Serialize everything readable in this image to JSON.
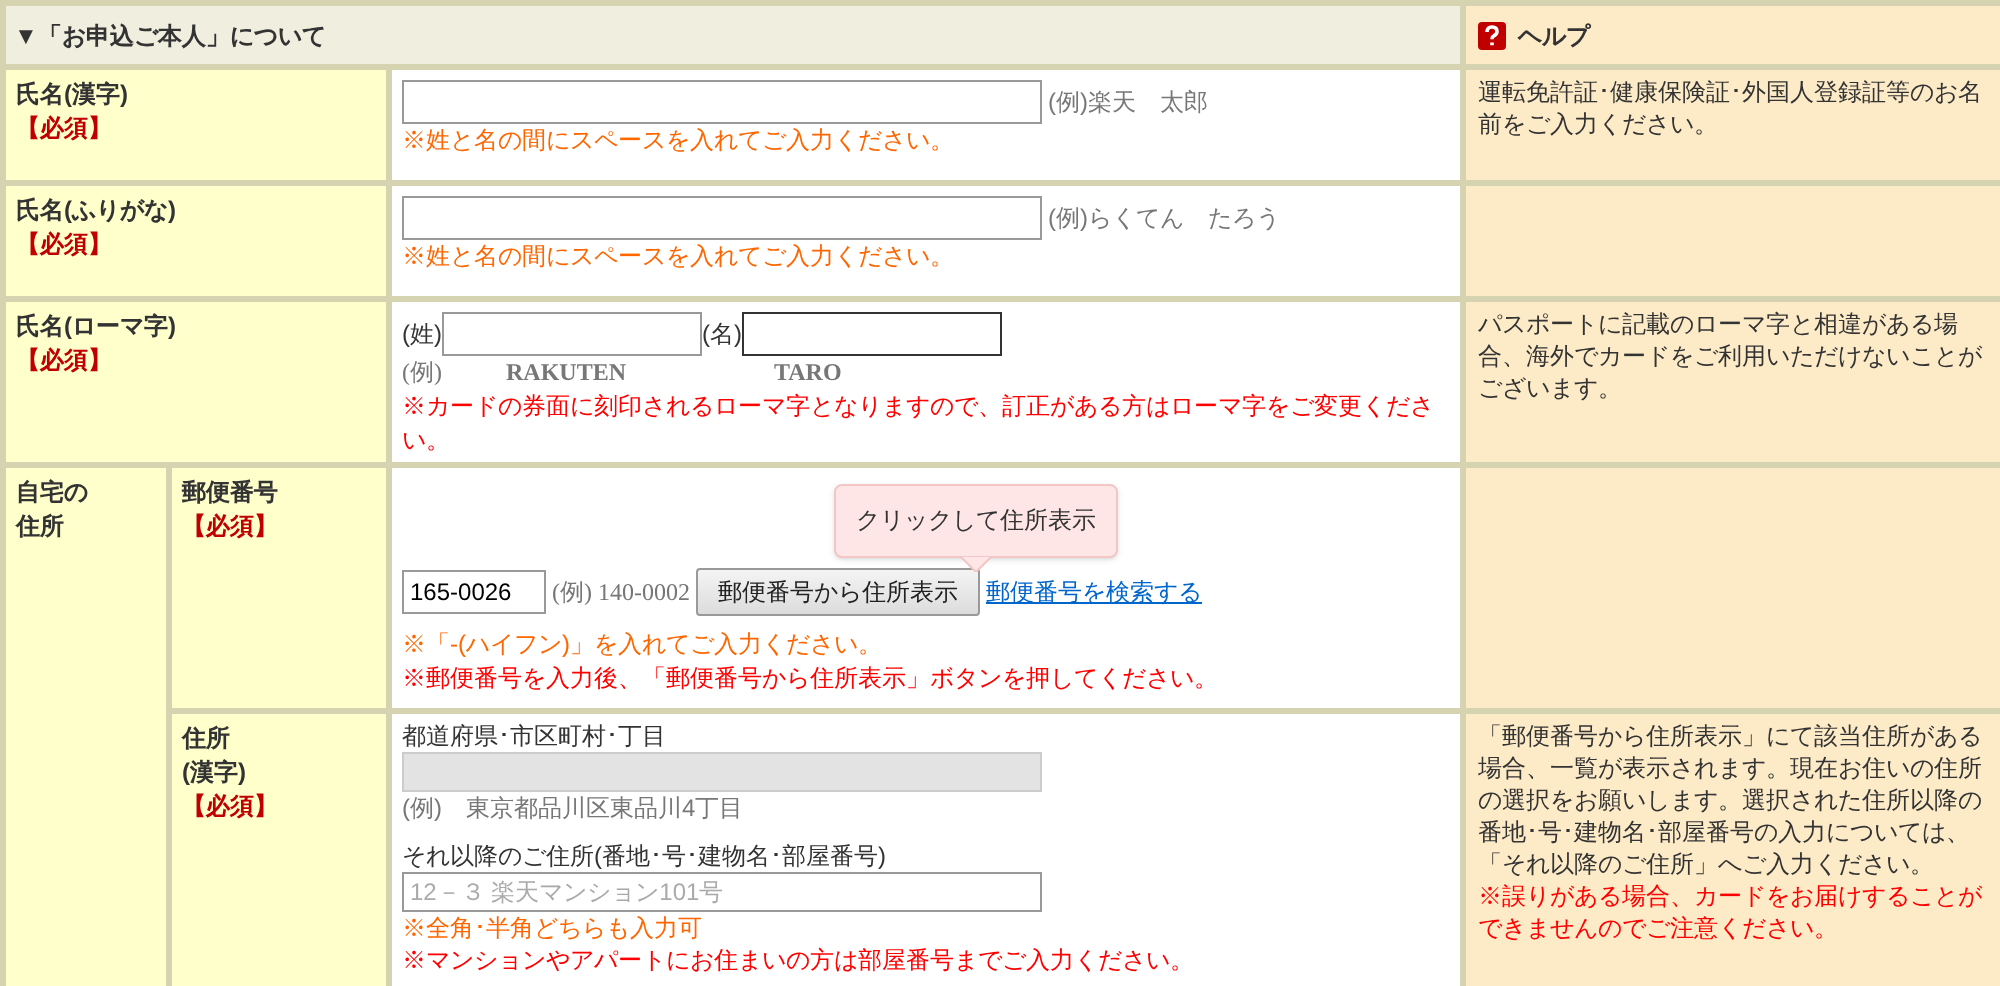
{
  "section": {
    "title": "▼「お申込ご本人」について"
  },
  "help_header": {
    "title": "ヘルプ"
  },
  "rows": [
    {
      "kind": "single",
      "label": [
        "氏名(漢字)"
      ],
      "required": "【必須】",
      "input": {
        "focused": false
      },
      "example": "(例)楽天　太郎",
      "notes": [
        {
          "text": "※姓と名の間にスペースを入れてご入力ください。",
          "color": "#ff6600"
        }
      ],
      "help": [
        {
          "text": "運転免許証･健康保険証･外国人登録証等のお名前をご入力ください。",
          "color": "#333333"
        }
      ]
    },
    {
      "kind": "single",
      "label": [
        "氏名(ふりがな)"
      ],
      "required": "【必須】",
      "input": {
        "focused": false
      },
      "example": "(例)らくてん　たろう",
      "notes": [
        {
          "text": "※姓と名の間にスペースを入れてご入力ください。",
          "color": "#ff6600"
        }
      ],
      "help": []
    },
    {
      "kind": "split",
      "label": [
        "氏名(ローマ字)"
      ],
      "required": "【必須】",
      "example_prefix": "(例)",
      "fields": [
        {
          "prefix": "(姓)",
          "focused": false,
          "example": "RAKUTEN"
        },
        {
          "prefix": "(名)",
          "focused": true,
          "example": "TARO"
        }
      ],
      "notes": [
        {
          "text": "※カードの券面に刻印されるローマ字となりますので、訂正がある方はローマ字をご変更ください。",
          "color": "#ff0000"
        }
      ],
      "help": [
        {
          "text": "パスポートに記載のローマ字と相違がある場合、海外でカードをご利用いただけないことがございます。",
          "color": "#333333"
        }
      ]
    }
  ],
  "address_group": {
    "label": [
      "自宅の",
      "住所"
    ],
    "rows": [
      {
        "kind": "postal",
        "label": [
          "郵便番号"
        ],
        "required": "【必須】",
        "tooltip": "クリックして住所表示",
        "input": {
          "value": "165-0026",
          "focused": false
        },
        "example": "(例) 140-0002",
        "button": "郵便番号から住所表示",
        "link": "郵便番号を検索する",
        "notes": [
          {
            "text": "※「-(ハイフン)」を入れてご入力ください。",
            "color": "#ff6600"
          },
          {
            "text": "※郵便番号を入力後、「郵便番号から住所表示」ボタンを押してください。",
            "color": "#ff0000"
          }
        ],
        "help": []
      },
      {
        "kind": "address",
        "label": [
          "住所",
          "(漢字)"
        ],
        "required": "【必須】",
        "fields": [
          {
            "heading": "都道府県･市区町村･丁目",
            "disabled": true,
            "example": "(例)　東京都品川区東品川4丁目"
          },
          {
            "heading": "それ以降のご住所(番地･号･建物名･部屋番号)",
            "disabled": false,
            "placeholder": "12－３ 楽天マンション101号"
          }
        ],
        "notes": [
          {
            "text": "※全角･半角どちらも入力可",
            "color": "#ff6600"
          },
          {
            "text": "※マンションやアパートにお住まいの方は部屋番号までご入力ください。",
            "color": "#ff0000"
          }
        ],
        "help": [
          {
            "text": "「郵便番号から住所表示」にて該当住所がある場合、一覧が表示されます。現在お住いの住所の選択をお願いします。選択された住所以降の番地･号･建物名･部屋番号の入力については、「それ以降のご住所」へご入力ください。",
            "color": "#333333"
          },
          {
            "text": "※誤りがある場合、カードをお届けすることができませんのでご注意ください。",
            "color": "#ff0000"
          }
        ]
      }
    ]
  }
}
